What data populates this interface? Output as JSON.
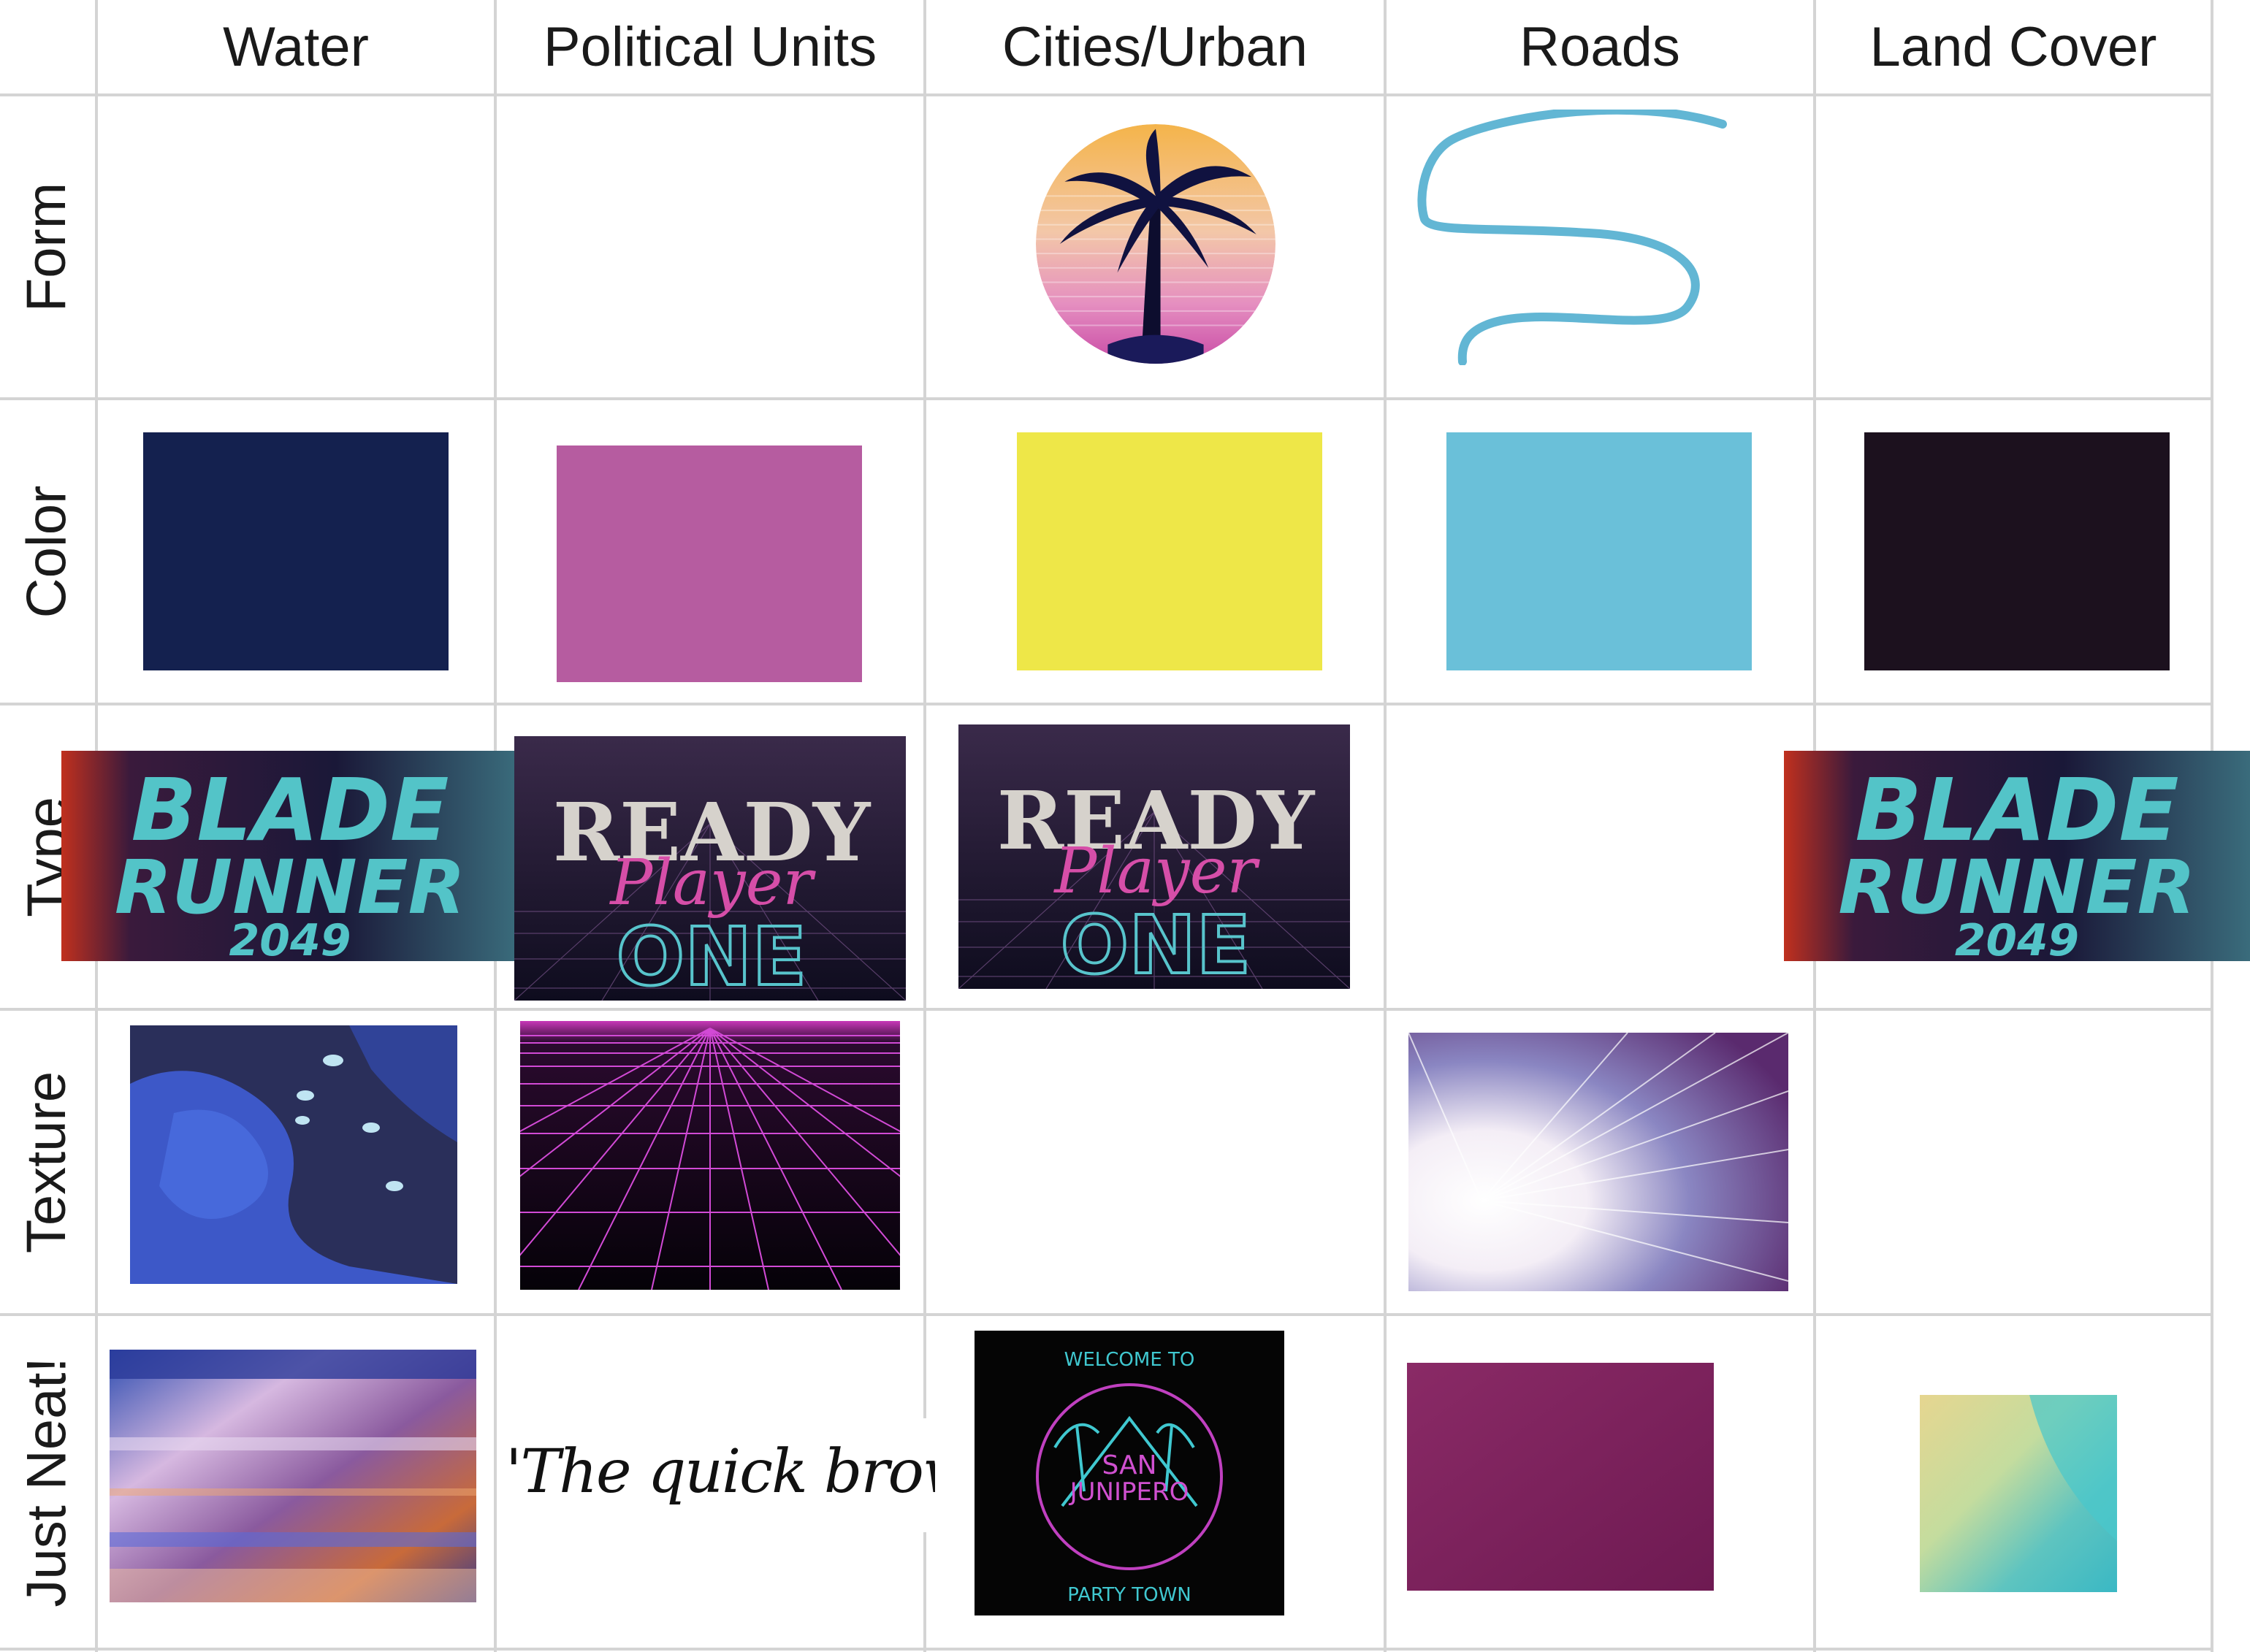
{
  "columns": [
    "Water",
    "Political Units",
    "Cities/Urban",
    "Roads",
    "Land Cover"
  ],
  "rows": [
    "Form",
    "Color",
    "Type",
    "Texture",
    "Just Neat!"
  ],
  "colors": {
    "water": "#14214f",
    "political_units": "#b65ca0",
    "cities_urban": "#eee748",
    "roads": "#6ac0d9",
    "land_cover": "#1c111e",
    "grid_line": "#d4d4d4"
  },
  "samples": {
    "form_cities_icon": "palm-tree-sunset-icon",
    "form_roads_icon": "squiggle-line-icon",
    "type_blade_runner": {
      "line1": "BLADE",
      "line2": "RUNNER",
      "line3": "2049"
    },
    "type_ready_player": {
      "line1": "READY",
      "line2": "Player",
      "line3": "ONE"
    },
    "neat_fox_text": "'The quick brown fox,",
    "neat_sign": {
      "top": "WELCOME TO",
      "line1": "SAN",
      "line2": "JUNIPERO",
      "bottom": "PARTY TOWN"
    }
  }
}
